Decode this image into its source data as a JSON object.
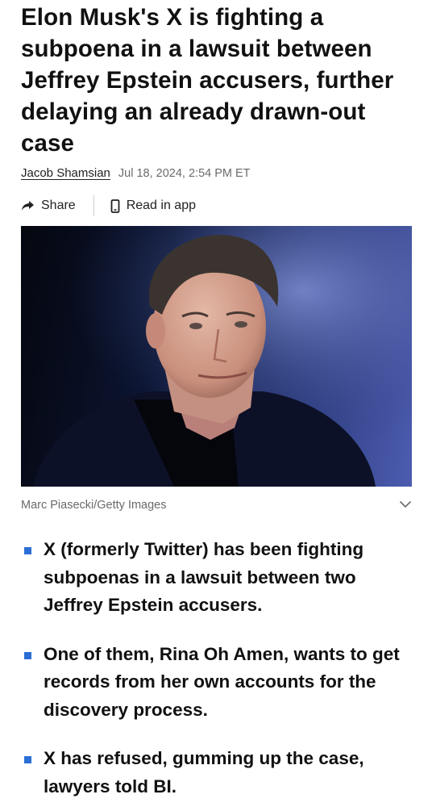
{
  "article": {
    "headline": "Elon Musk's X is fighting a subpoena in a lawsuit between Jeffrey Epstein accusers, further delaying an already drawn-out case",
    "author": "Jacob Shamsian",
    "date": "Jul 18, 2024, 2:54 PM ET"
  },
  "actions": {
    "share_label": "Share",
    "read_in_app_label": "Read in app",
    "share_icon": "share-arrow-icon",
    "phone_icon": "phone-icon"
  },
  "image": {
    "caption": "Marc Piasecki/Getty Images"
  },
  "bullets": [
    "X (formerly Twitter) has been fighting subpoenas in a lawsuit between two Jeffrey Epstein accusers.",
    "One of them, Rina Oh Amen, wants to get records from her own accounts for the discovery process.",
    "X has refused, gumming up the case, lawyers told BI."
  ],
  "colors": {
    "bullet_marker": "#2b6fd6",
    "byline_date": "#6b6b6b"
  }
}
